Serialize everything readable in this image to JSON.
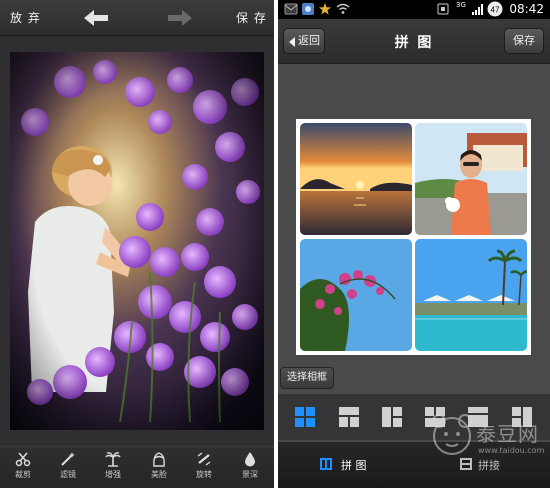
{
  "left_screen": {
    "topbar": {
      "discard_label": "放 弃",
      "save_label": "保 存",
      "undo_icon": "undo-arrow-icon",
      "redo_icon": "redo-arrow-icon"
    },
    "toolbar": {
      "items": [
        {
          "label": "裁剪",
          "icon": "scissors-icon"
        },
        {
          "label": "滤镜",
          "icon": "magic-wand-icon"
        },
        {
          "label": "增强",
          "icon": "palm-tree-icon"
        },
        {
          "label": "美脸",
          "icon": "face-icon"
        },
        {
          "label": "旋转",
          "icon": "rotate-icon"
        },
        {
          "label": "景深",
          "icon": "drop-icon"
        }
      ]
    }
  },
  "right_screen": {
    "status_bar": {
      "time": "08:42",
      "network": "3G",
      "battery": "47"
    },
    "header": {
      "back_label": "返回",
      "title": "拼 图",
      "save_label": "保存"
    },
    "select_frame_label": "选择相框",
    "tabs": [
      {
        "label": "拼 图",
        "active": true
      },
      {
        "label": "拼接",
        "active": false
      }
    ],
    "watermark": {
      "text": "泰豆网",
      "url": "www.taidou.com"
    }
  },
  "colors": {
    "accent_blue": "#1e90ff",
    "dark_bg": "#2f2f31",
    "right_bg": "#4a4a4c"
  }
}
